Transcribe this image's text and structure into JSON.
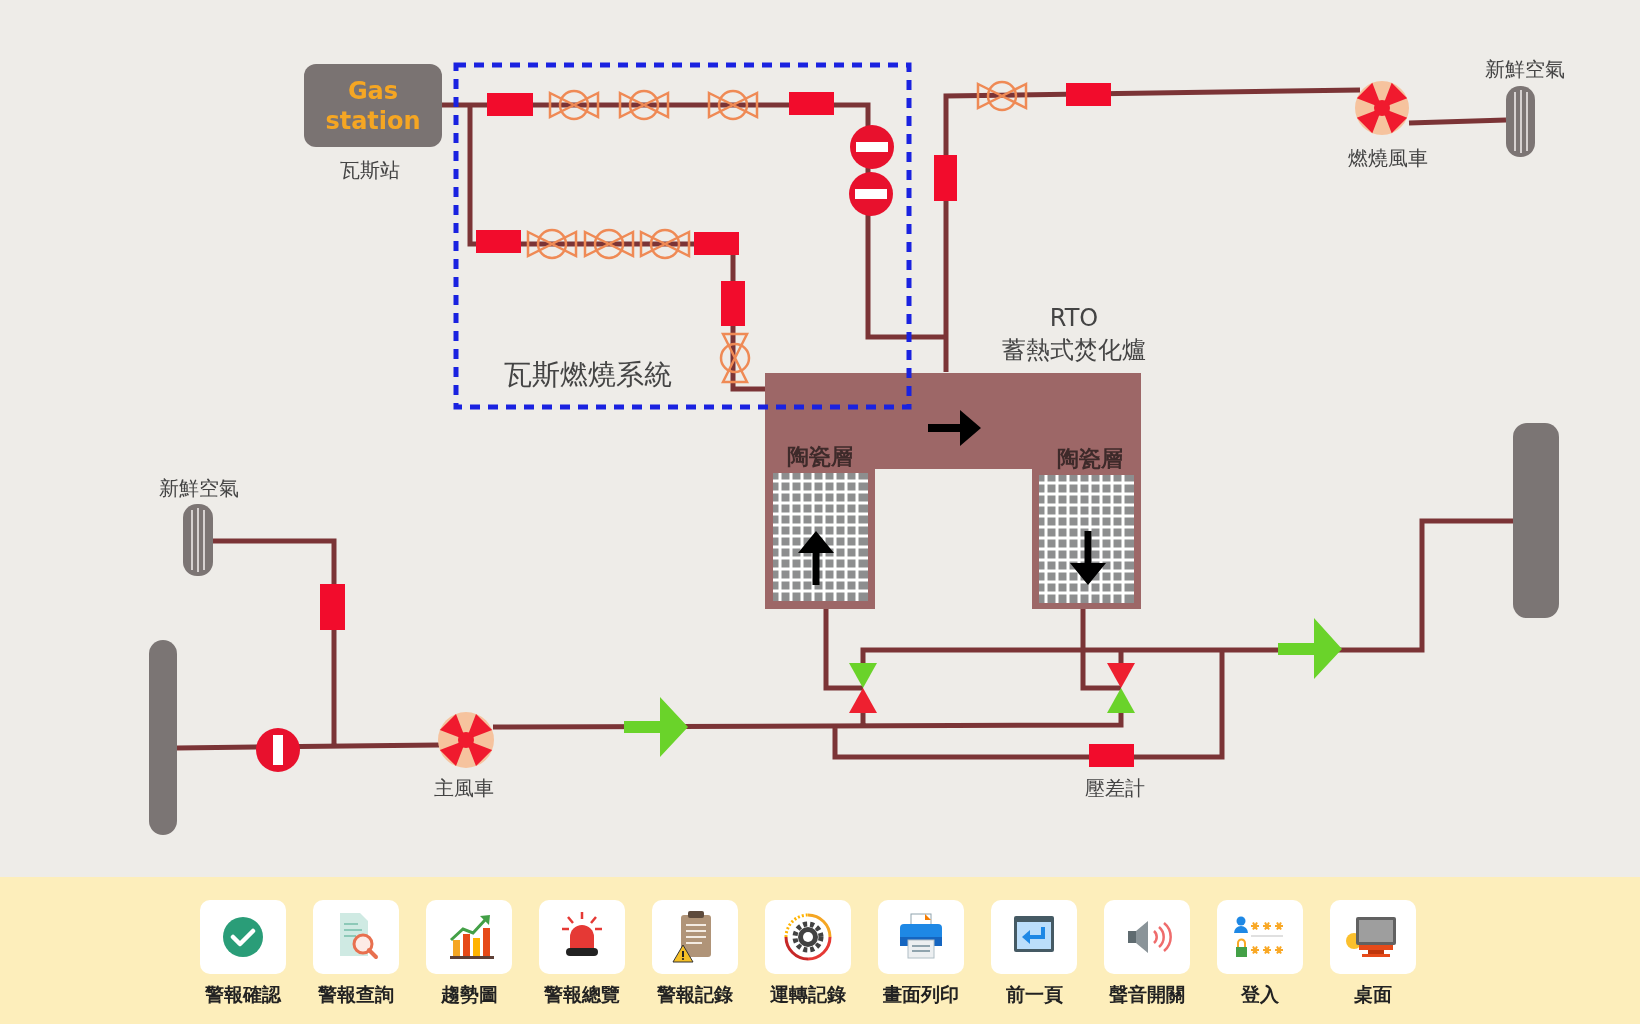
{
  "gas_station": {
    "label": "Gas station",
    "caption": "瓦斯站"
  },
  "gas_combustion_system": {
    "label": "瓦斯燃燒系統"
  },
  "combustion_fan": {
    "label": "燃燒風車"
  },
  "fresh_air_inlets": [
    {
      "label": "新鮮空氣"
    },
    {
      "label": "新鮮空氣"
    }
  ],
  "rto": {
    "title": "RTO",
    "subtitle": "蓄熱式焚化爐",
    "beds": [
      {
        "label": "陶瓷層",
        "flow_up": true
      },
      {
        "label": "陶瓷層",
        "flow_up": false
      }
    ]
  },
  "main_fan": {
    "label": "主風車"
  },
  "switch_valves": [
    {
      "upper_open": true,
      "lower_open": false
    },
    {
      "upper_open": false,
      "lower_open": true
    }
  ],
  "differential_pressure_gauge": {
    "label": "壓差計"
  },
  "toolbar": [
    {
      "label": "警報確認"
    },
    {
      "label": "警報查詢"
    },
    {
      "label": "趨勢圖"
    },
    {
      "label": "警報總覽"
    },
    {
      "label": "警報記錄"
    },
    {
      "label": "運轉記錄"
    },
    {
      "label": "畫面列印"
    },
    {
      "label": "前一頁"
    },
    {
      "label": "聲音開關"
    },
    {
      "label": "登入"
    },
    {
      "label": "桌面"
    }
  ]
}
